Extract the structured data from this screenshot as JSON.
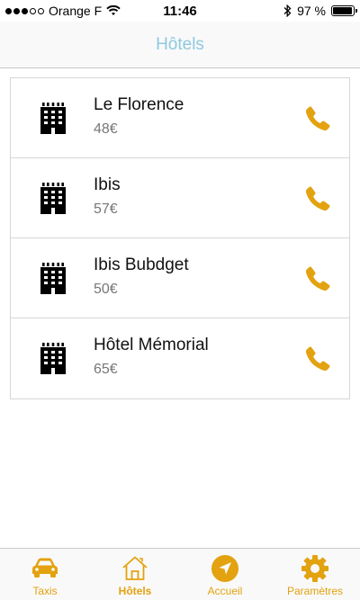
{
  "status_bar": {
    "carrier": "Orange F",
    "time": "11:46",
    "battery": "97 %",
    "battery_level": 0.97
  },
  "nav": {
    "title": "Hôtels"
  },
  "hotels": [
    {
      "name": "Le Florence",
      "price": "48€"
    },
    {
      "name": "Ibis",
      "price": "57€"
    },
    {
      "name": "Ibis Bubdget",
      "price": "50€"
    },
    {
      "name": "Hôtel Mémorial",
      "price": "65€"
    }
  ],
  "tabs": [
    {
      "label": "Taxis",
      "icon": "car-icon"
    },
    {
      "label": "Hôtels",
      "icon": "house-icon",
      "active": true
    },
    {
      "label": "Accueil",
      "icon": "navigation-arrow-icon"
    },
    {
      "label": "Paramètres",
      "icon": "gear-icon"
    }
  ],
  "colors": {
    "accent": "#e3a20f",
    "title": "#8ec9df"
  }
}
